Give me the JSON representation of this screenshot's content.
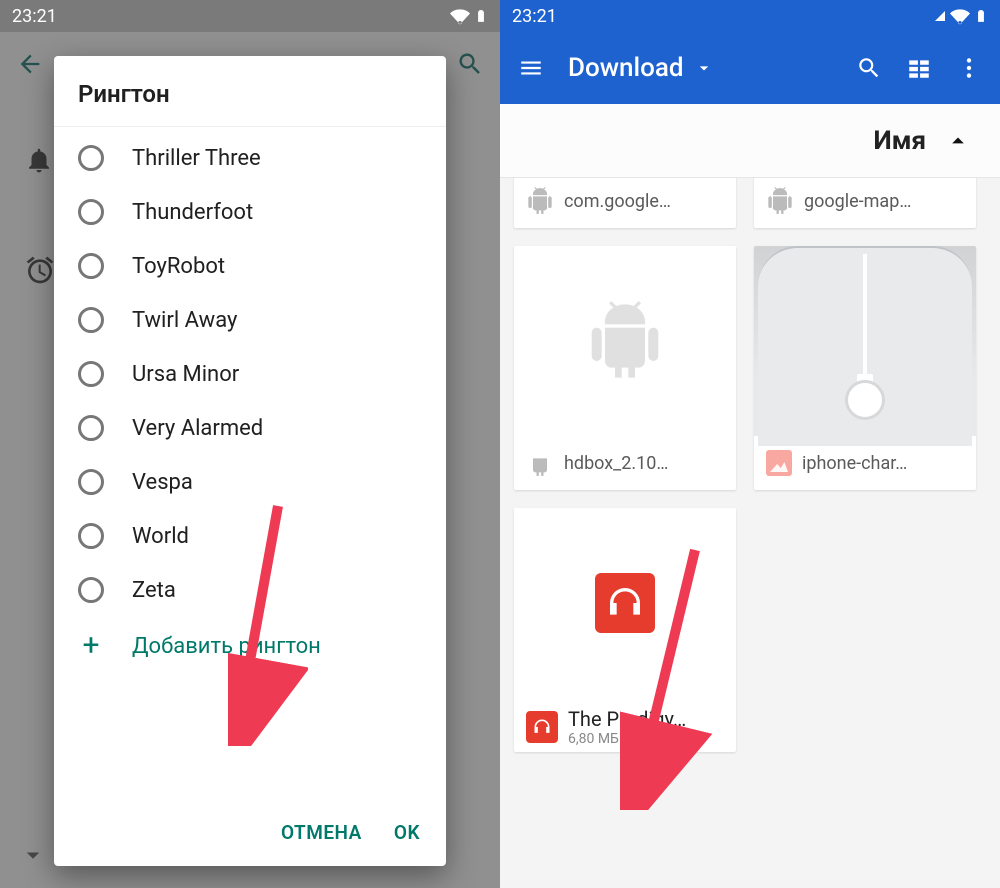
{
  "left": {
    "status_time": "23:21",
    "dialog_title": "Рингтон",
    "ringtones": [
      "Thriller Three",
      "Thunderfoot",
      "ToyRobot",
      "Twirl Away",
      "Ursa Minor",
      "Very Alarmed",
      "Vespa",
      "World",
      "Zeta"
    ],
    "add_label": "Добавить рингтон",
    "cancel": "ОТМЕНА",
    "ok": "OK"
  },
  "right": {
    "status_time": "23:21",
    "appbar_title": "Download",
    "sort_label": "Имя",
    "files": {
      "top_left": "com.google…",
      "top_right": "google-map…",
      "mid_left": "hdbox_2.10…",
      "mid_right": "iphone-char…",
      "music_title": "The Prodigy…",
      "music_sub": "6,80 МБ 23:02"
    }
  }
}
